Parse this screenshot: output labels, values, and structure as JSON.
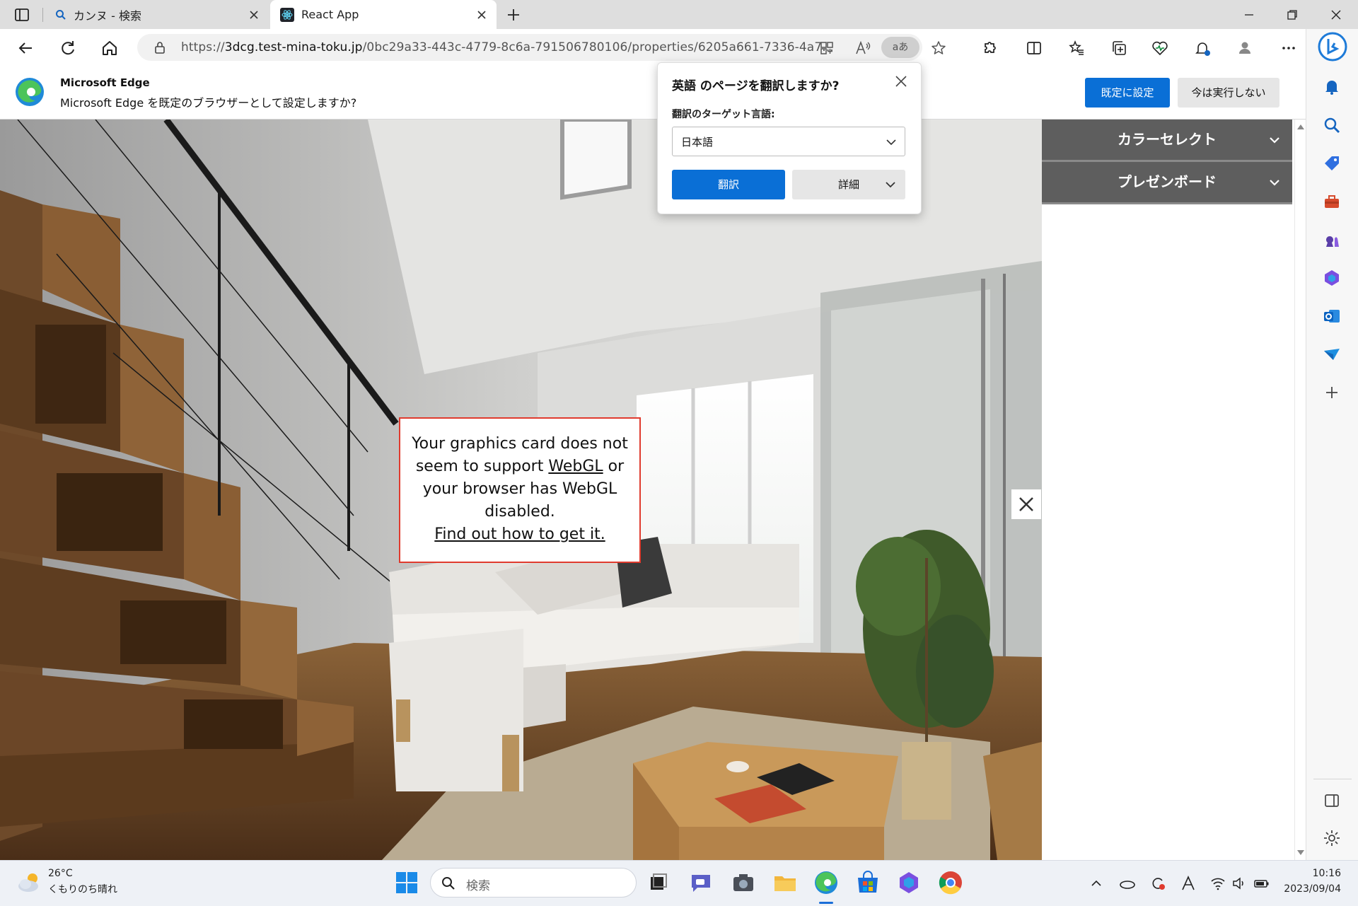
{
  "browser": {
    "tabs": [
      {
        "label": "カンヌ - 検索",
        "icon": "search-icon"
      },
      {
        "label": "React App",
        "icon": "react-icon"
      }
    ],
    "url_prefix": "https://",
    "url_host": "3dcg.test-mina-toku.jp",
    "url_path": "/0bc29a33-443c-4779-8c6a-791506780106/properties/6205a661-7336-4a7...",
    "read_aloud_badge": "aあ"
  },
  "infobar": {
    "title": "Microsoft Edge",
    "message": "Microsoft Edge を既定のブラウザーとして設定しますか?",
    "primary_button": "既定に設定",
    "secondary_button": "今は実行しない"
  },
  "translate_popup": {
    "title": "英語 のページを翻訳しますか?",
    "target_label": "翻訳のターゲット言語:",
    "target_value": "日本語",
    "translate_button": "翻訳",
    "more_button": "詳細"
  },
  "webgl_error": {
    "line1": "Your graphics card does not seem to support",
    "link1": "WebGL",
    "line2": "or your browser has WebGL disabled.",
    "link2": "Find out how to get it."
  },
  "panel": {
    "sections": [
      "カラーセレクト",
      "プレゼンボード"
    ]
  },
  "taskbar": {
    "weather_temp": "26°C",
    "weather_desc": "くもりのち晴れ",
    "search_placeholder": "検索",
    "time": "10:16",
    "date": "2023/09/04"
  },
  "colors": {
    "accent": "#0a6fd6",
    "panel_header": "#5e5e5e",
    "error_border": "#e03b2e"
  }
}
